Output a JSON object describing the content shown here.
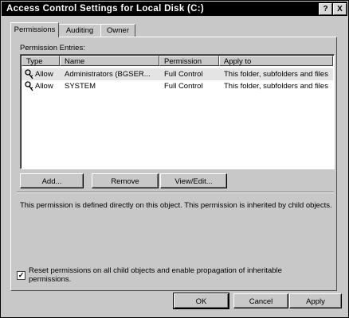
{
  "window": {
    "title": "Access Control Settings for Local Disk (C:)"
  },
  "titlebar_buttons": {
    "help": "?",
    "close": "X"
  },
  "tabs": [
    {
      "label": "Permissions",
      "active": true
    },
    {
      "label": "Auditing",
      "active": false
    },
    {
      "label": "Owner",
      "active": false
    }
  ],
  "permission_entries": {
    "label": "Permission Entries:",
    "columns": [
      "Type",
      "Name",
      "Permission",
      "Apply to"
    ],
    "rows": [
      {
        "icon": "key-icon",
        "type": "Allow",
        "name": "Administrators (BGSER...",
        "permission": "Full Control",
        "apply_to": "This folder, subfolders and files",
        "selected": true
      },
      {
        "icon": "key-icon",
        "type": "Allow",
        "name": "SYSTEM",
        "permission": "Full Control",
        "apply_to": "This folder, subfolders and files",
        "selected": false
      }
    ]
  },
  "buttons": {
    "add": "Add...",
    "remove": "Remove",
    "view_edit": "View/Edit..."
  },
  "description": "This permission is defined directly on this object. This permission is inherited by child objects.",
  "reset_option": {
    "checked": true,
    "mark": "✓",
    "label": "Reset permissions on all child objects and enable propagation of inheritable permissions."
  },
  "footer": {
    "ok": "OK",
    "cancel": "Cancel",
    "apply": "Apply"
  }
}
